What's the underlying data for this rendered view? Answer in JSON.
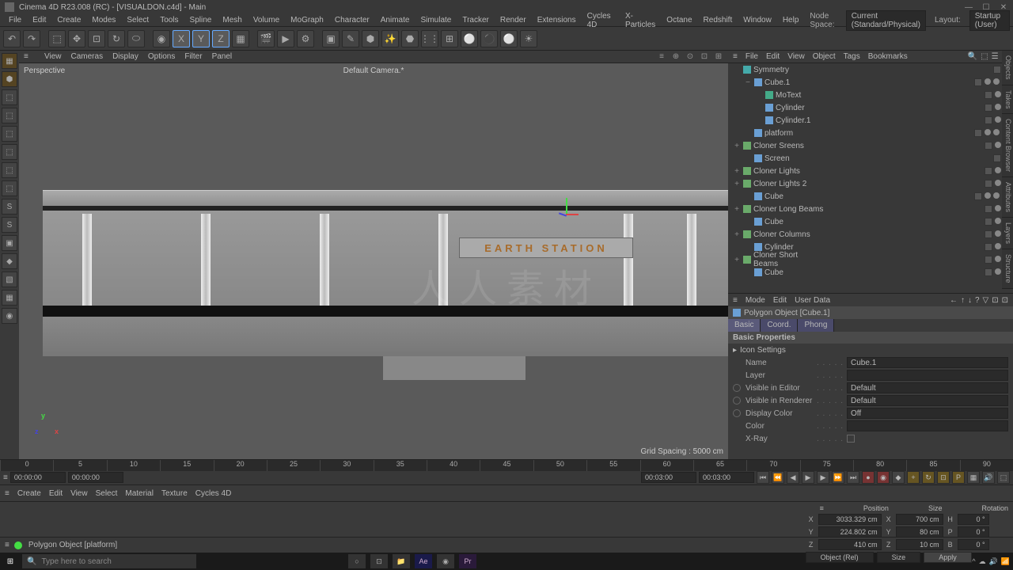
{
  "titlebar": {
    "text": "Cinema 4D R23.008 (RC) - [VISUALDON.c4d] - Main"
  },
  "winctrl": {
    "min": "—",
    "max": "☐",
    "close": "✕"
  },
  "menubar": {
    "items": [
      "File",
      "Edit",
      "Create",
      "Modes",
      "Select",
      "Tools",
      "Spline",
      "Mesh",
      "Volume",
      "MoGraph",
      "Character",
      "Animate",
      "Simulate",
      "Tracker",
      "Render",
      "Extensions",
      "Cycles 4D",
      "X-Particles",
      "Octane",
      "Redshift",
      "Window",
      "Help"
    ],
    "right": {
      "nodespace_lbl": "Node Space:",
      "nodespace_val": "Current (Standard/Physical)",
      "layout_lbl": "Layout:",
      "layout_val": "Startup (User)"
    }
  },
  "toolbar": {
    "icons": [
      "↶",
      "↷",
      "|",
      "⬚",
      "✥",
      "⊡",
      "↻",
      "⬭",
      "|",
      "◉",
      "X",
      "Y",
      "Z",
      "▦",
      "|",
      "🎬",
      "▶",
      "⚙",
      "|",
      "▣",
      "✎",
      "⬢",
      "✨",
      "⬣",
      "⋮⋮",
      "⊞",
      "⚪",
      "⚫",
      "⚪",
      "☀"
    ]
  },
  "lefttools": [
    "▦",
    "⬢",
    "⬚",
    "⬚",
    "⬚",
    "⬚",
    "⬚",
    "⬚",
    "S",
    "S",
    "▣",
    "◆",
    "▧",
    "▦",
    "◉"
  ],
  "viewmenu": {
    "items": [
      "View",
      "Cameras",
      "Display",
      "Options",
      "Filter",
      "Panel"
    ],
    "buttons": [
      "≡",
      "⊕",
      "⊙",
      "⊡",
      "⊞"
    ]
  },
  "viewport": {
    "label": "Perspective",
    "camera": "Default Camera.*",
    "grid": "Grid Spacing : 5000 cm",
    "signtext": "EARTH STATION"
  },
  "objmanager": {
    "menu": [
      "File",
      "Edit",
      "View",
      "Object",
      "Tags",
      "Bookmarks"
    ],
    "tree": [
      {
        "d": 0,
        "exp": "",
        "icon": "sym",
        "name": "Symmetry",
        "t": [
          "chk",
          "dot"
        ]
      },
      {
        "d": 1,
        "exp": "−",
        "icon": "cube",
        "name": "Cube.1",
        "t": [
          "chk",
          "dot",
          "dot",
          "tagx"
        ]
      },
      {
        "d": 2,
        "exp": "",
        "icon": "txt",
        "name": "MoText",
        "t": [
          "chk",
          "dot",
          "dot"
        ]
      },
      {
        "d": 2,
        "exp": "",
        "icon": "cyl",
        "name": "Cylinder",
        "t": [
          "chk",
          "dot",
          "dot"
        ]
      },
      {
        "d": 2,
        "exp": "",
        "icon": "cyl",
        "name": "Cylinder.1",
        "t": [
          "chk",
          "dot",
          "dot"
        ]
      },
      {
        "d": 1,
        "exp": "",
        "icon": "cube",
        "name": "platform",
        "t": [
          "chk",
          "dot",
          "dot",
          "tagx"
        ]
      },
      {
        "d": 0,
        "exp": "+",
        "icon": "clo",
        "name": "Cloner Sreens",
        "t": [
          "chk",
          "dot",
          "g"
        ]
      },
      {
        "d": 1,
        "exp": "",
        "icon": "cube",
        "name": "Screen",
        "t": [
          "chk",
          "dot"
        ]
      },
      {
        "d": 0,
        "exp": "+",
        "icon": "clo",
        "name": "Cloner Lights",
        "t": [
          "chk",
          "dot",
          "g"
        ]
      },
      {
        "d": 0,
        "exp": "+",
        "icon": "clo",
        "name": "Cloner Lights 2",
        "t": [
          "chk",
          "dot",
          "g"
        ]
      },
      {
        "d": 1,
        "exp": "",
        "icon": "cube",
        "name": "Cube",
        "t": [
          "chk",
          "dot",
          "dot",
          "tagx"
        ]
      },
      {
        "d": 0,
        "exp": "+",
        "icon": "clo",
        "name": "Cloner Long Beams",
        "t": [
          "chk",
          "dot",
          "g"
        ]
      },
      {
        "d": 1,
        "exp": "",
        "icon": "cube",
        "name": "Cube",
        "t": [
          "chk",
          "dot",
          "dot"
        ]
      },
      {
        "d": 0,
        "exp": "+",
        "icon": "clo",
        "name": "Cloner Columns",
        "t": [
          "chk",
          "dot",
          "g"
        ]
      },
      {
        "d": 1,
        "exp": "",
        "icon": "cyl",
        "name": "Cylinder",
        "t": [
          "chk",
          "dot",
          "dot"
        ]
      },
      {
        "d": 0,
        "exp": "+",
        "icon": "clo",
        "name": "Cloner Short Beams",
        "t": [
          "chk",
          "dot",
          "g"
        ]
      },
      {
        "d": 1,
        "exp": "",
        "icon": "cube",
        "name": "Cube",
        "t": [
          "chk",
          "dot",
          "dot"
        ]
      }
    ]
  },
  "attrs": {
    "menu": [
      "Mode",
      "Edit",
      "User Data"
    ],
    "header": "Polygon Object [Cube.1]",
    "tabs": [
      "Basic",
      "Coord.",
      "Phong"
    ],
    "section": "Basic Properties",
    "iconsettings": "Icon Settings",
    "rows": [
      {
        "lbl": "Name",
        "val": "Cube.1"
      },
      {
        "lbl": "Layer",
        "val": ""
      },
      {
        "lbl": "Visible in Editor",
        "val": "Default",
        "b": true
      },
      {
        "lbl": "Visible in Renderer",
        "val": "Default",
        "b": true
      },
      {
        "lbl": "Display Color",
        "val": "Off",
        "b": true
      },
      {
        "lbl": "Color",
        "val": ""
      },
      {
        "lbl": "X-Ray",
        "val": "",
        "chk": true
      }
    ]
  },
  "timeline": {
    "ticks": [
      "0",
      "5",
      "10",
      "15",
      "20",
      "25",
      "30",
      "35",
      "40",
      "45",
      "50",
      "55",
      "60",
      "65",
      "70",
      "75",
      "80",
      "85",
      "90"
    ],
    "t0": "00:00:00",
    "t1": "00:00:00",
    "t2": "00:03:00",
    "t3": "00:03:00"
  },
  "matmenu": [
    "Create",
    "Edit",
    "View",
    "Select",
    "Material",
    "Texture",
    "Cycles 4D"
  ],
  "coord": {
    "head": [
      "Position",
      "Size",
      "Rotation"
    ],
    "rows": [
      {
        "a": "X",
        "pv": "3033.329 cm",
        "sl": "X",
        "sv": "700 cm",
        "rl": "H",
        "rv": "0 °"
      },
      {
        "a": "Y",
        "pv": "224.802 cm",
        "sl": "Y",
        "sv": "80 cm",
        "rl": "P",
        "rv": "0 °"
      },
      {
        "a": "Z",
        "pv": "410 cm",
        "sl": "Z",
        "sv": "10 cm",
        "rl": "B",
        "rv": "0 °"
      }
    ],
    "foot": {
      "obj": "Object (Rel)",
      "size": "Size",
      "apply": "Apply"
    }
  },
  "status": "Polygon Object [platform]",
  "wintaskbar": {
    "search": "Type here to search"
  },
  "sidetabs": [
    "Objects",
    "Takes",
    "Content Browser",
    "Attributes",
    "Layers",
    "Structure"
  ]
}
